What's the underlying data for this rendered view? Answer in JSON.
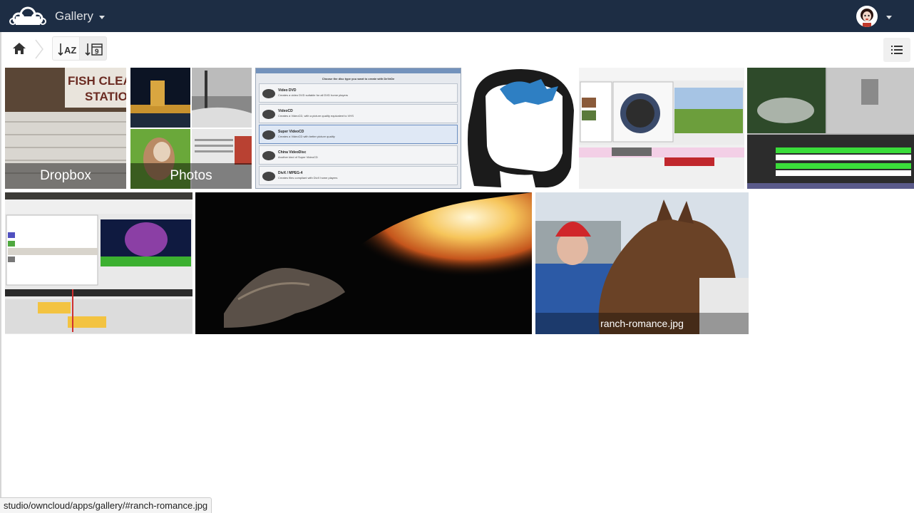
{
  "header": {
    "app_name": "Gallery"
  },
  "controls": {
    "sort_name_label": "AZ",
    "sort_date_label": "9"
  },
  "albums": [
    {
      "label": "Dropbox"
    },
    {
      "label": "Photos"
    }
  ],
  "files": [
    {
      "label": "ranch-romance.jpg"
    }
  ],
  "dvd_dialog": {
    "title": "Choose the disc type you want to create with DeVeDe",
    "options": [
      {
        "name": "Video DVD",
        "desc": "Creates a video DVD suitable for all DVD home players"
      },
      {
        "name": "VideoCD",
        "desc": "Creates a VideoCD, with a picture quality equivalent to VHS"
      },
      {
        "name": "Super VideoCD",
        "desc": "Creates a VideoCD with better picture quality"
      },
      {
        "name": "China VideoDisc",
        "desc": "Another kind of Super VideoCD"
      },
      {
        "name": "DivX / MPEG-4",
        "desc": "Creates files compliant with DivX home players"
      }
    ]
  },
  "status_url": "studio/owncloud/apps/gallery/#ranch-romance.jpg"
}
